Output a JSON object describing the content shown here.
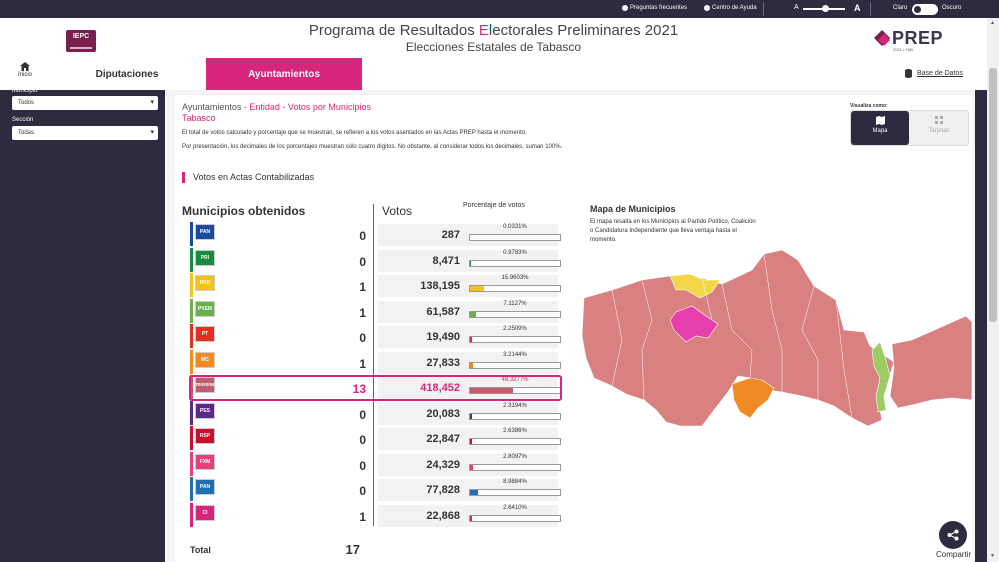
{
  "topbar": {
    "faq": "Preguntas frecuentes",
    "help": "Centro de Ayuda",
    "font_small": "A",
    "font_large": "A",
    "theme_light": "Claro",
    "theme_dark": "Oscuro"
  },
  "header": {
    "logo": "IEPC",
    "title_part1": "Programa de Resultados ",
    "title_hl": "E",
    "title_part2": "lectorales Preliminares 2021",
    "subtitle": "Elecciones Estatales de Tabasco",
    "prep_logo": "PREP",
    "prep_sub": "2021 • TAB"
  },
  "nav": {
    "home": "Inicio",
    "tab_diputaciones": "Diputaciones",
    "tab_ayuntamientos": "Ayuntamientos",
    "base_datos": "Base de Datos"
  },
  "sidebar": {
    "municipio_label": "Municipio",
    "municipio_value": "Todos",
    "seccion_label": "Sección",
    "seccion_value": "Todas"
  },
  "main": {
    "crumb_a": "Ayuntamientos - ",
    "crumb_b": "Entidad",
    "crumb_c": " - Votos por Municipios",
    "crumb_state": "Tabasco",
    "note1": "El total de votos calculado y porcentaje que se muestran, se refieren a los votos asentados en las Actas PREP hasta el momento.",
    "note2": "Por presentación, los decimales de los porcentajes muestran sólo cuatro dígitos. No obstante, al considerar todos los decimales, suman 100%.",
    "vis_label": "Visualiza como:",
    "vis_mapa": "Mapa",
    "vis_tarjetas": "Tarjetas",
    "section_title": "Votos en Actas Contabilizadas",
    "th_municipios": "Municipios obtenidos",
    "th_votos": "Votos",
    "th_pct": "Porcentaje de votos",
    "total_label": "Total",
    "total_value": "17"
  },
  "rows": [
    {
      "logo": "PAN",
      "color": "#1a4b9c",
      "municipios": "0",
      "votos": "287",
      "pct_label": "0.0331%",
      "pct": 0.0331
    },
    {
      "logo": "PRI",
      "color": "#1a8a3c",
      "municipios": "0",
      "votos": "8,471",
      "pct_label": "0.9783%",
      "pct": 0.9783
    },
    {
      "logo": "PRD",
      "color": "#f2c318",
      "municipios": "1",
      "votos": "138,195",
      "pct_label": "15.9603%",
      "pct": 15.9603
    },
    {
      "logo": "PVEM",
      "color": "#6ab04c",
      "municipios": "1",
      "votos": "61,587",
      "pct_label": "7.1127%",
      "pct": 7.1127
    },
    {
      "logo": "PT",
      "color": "#e0301e",
      "municipios": "0",
      "votos": "19,490",
      "pct_label": "2.2509%",
      "pct": 2.2509
    },
    {
      "logo": "MC",
      "color": "#f08a24",
      "municipios": "1",
      "votos": "27,833",
      "pct_label": "3.2144%",
      "pct": 3.2144
    },
    {
      "logo": "morena",
      "color": "#c45a6e",
      "municipios": "13",
      "votos": "418,452",
      "pct_label": "48.3277%",
      "pct": 48.3277
    },
    {
      "logo": "PES",
      "color": "#5b2a86",
      "municipios": "0",
      "votos": "20,083",
      "pct_label": "2.3194%",
      "pct": 2.3194
    },
    {
      "logo": "RSP",
      "color": "#c8102e",
      "municipios": "0",
      "votos": "22,847",
      "pct_label": "2.6386%",
      "pct": 2.6386
    },
    {
      "logo": "FXM",
      "color": "#e4407b",
      "municipios": "0",
      "votos": "24,329",
      "pct_label": "2.8097%",
      "pct": 2.8097
    },
    {
      "logo": "PAN PRI PRD",
      "color": "#1f6fb2",
      "municipios": "0",
      "votos": "77,828",
      "pct_label": "8.9884%",
      "pct": 8.9884
    },
    {
      "logo": "CI",
      "color": "#d6257b",
      "municipios": "1",
      "votos": "22,868",
      "pct_label": "2.6410%",
      "pct": 2.641
    }
  ],
  "map": {
    "title": "Mapa de Municipios",
    "description": "El mapa resalta en los Municipios al Partido Político, Coalición o Candidatura Independiente que lleva ventaja hasta el momento.",
    "colors": {
      "morena": "#d98080",
      "pvem": "#9ccc65",
      "prd": "#f2d74a",
      "mc": "#f08a24",
      "ci": "#e83fae"
    }
  },
  "share": {
    "label": "Compartir"
  },
  "colors": {
    "accent": "#d6257b",
    "dark": "#2e2a3f"
  }
}
